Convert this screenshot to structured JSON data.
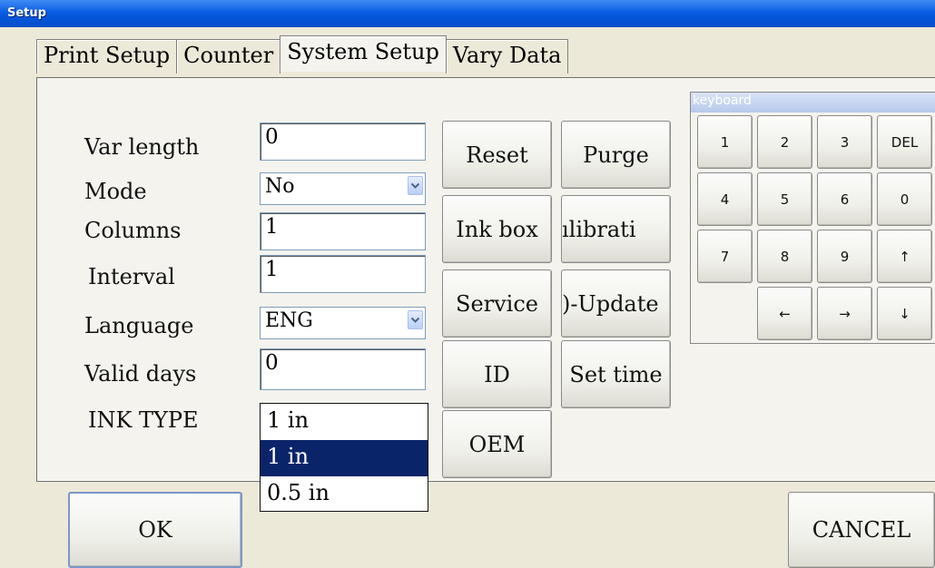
{
  "window": {
    "title": "Setup"
  },
  "tabs": [
    {
      "label": "Print Setup"
    },
    {
      "label": "Counter"
    },
    {
      "label": "System Setup"
    },
    {
      "label": "Vary Data"
    }
  ],
  "form": {
    "var_length": {
      "label": "Var length",
      "value": "0"
    },
    "mode": {
      "label": "Mode",
      "value": "No"
    },
    "columns": {
      "label": "Columns",
      "value": "1"
    },
    "interval": {
      "label": "Interval",
      "value": "1"
    },
    "language": {
      "label": "Language",
      "value": "ENG"
    },
    "valid_days": {
      "label": "Valid days",
      "value": "0"
    },
    "ink_type": {
      "label": "INK TYPE",
      "value": "1 in",
      "options": [
        "1 in",
        "0.5 in"
      ],
      "highlighted": "1 in"
    }
  },
  "buttons": {
    "reset": "Reset",
    "purge": "Purge",
    "ink_box": "Ink box",
    "calibration": "ılibrati",
    "service": "Service",
    "update": ")-Update",
    "id": "ID",
    "set_time": "Set time",
    "oem": "OEM"
  },
  "keyboard": {
    "title": "keyboard",
    "keys": [
      "1",
      "2",
      "3",
      "DEL",
      "4",
      "5",
      "6",
      "0",
      "7",
      "8",
      "9",
      "↑",
      "←",
      "→",
      "↓"
    ]
  },
  "footer": {
    "ok": "OK",
    "cancel": "CANCEL"
  },
  "colors": {
    "title_bar": "#0a5ce3",
    "selection": "#0a246a"
  },
  "icons": {
    "dropdown": "chevron-down-icon"
  }
}
